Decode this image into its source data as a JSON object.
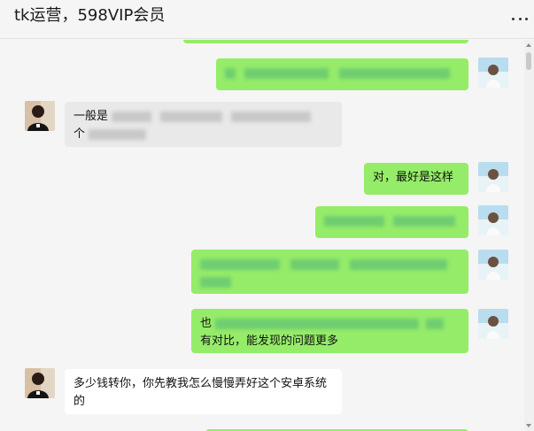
{
  "window": {
    "title": "tk运营，598VIP会员",
    "more_icon": "more-dots-icon"
  },
  "messages": [
    {
      "direction": "out",
      "text": ""
    },
    {
      "direction": "out",
      "text": ""
    },
    {
      "direction": "in",
      "text_line1": "一般是",
      "text_line2": "个"
    },
    {
      "direction": "out",
      "text": "对，最好是这样"
    },
    {
      "direction": "out",
      "text": ""
    },
    {
      "direction": "out",
      "text": ""
    },
    {
      "direction": "out",
      "text_line1": "也",
      "text_line2": "有对比，能发现的问题更多"
    },
    {
      "direction": "in",
      "text": "多少钱转你，你先教我怎么慢慢弄好这个安卓系统的"
    },
    {
      "direction": "out",
      "text": ""
    }
  ],
  "colors": {
    "outgoing_bubble": "#95ec69",
    "incoming_bubble": "#ffffff",
    "background": "#f5f5f5"
  }
}
